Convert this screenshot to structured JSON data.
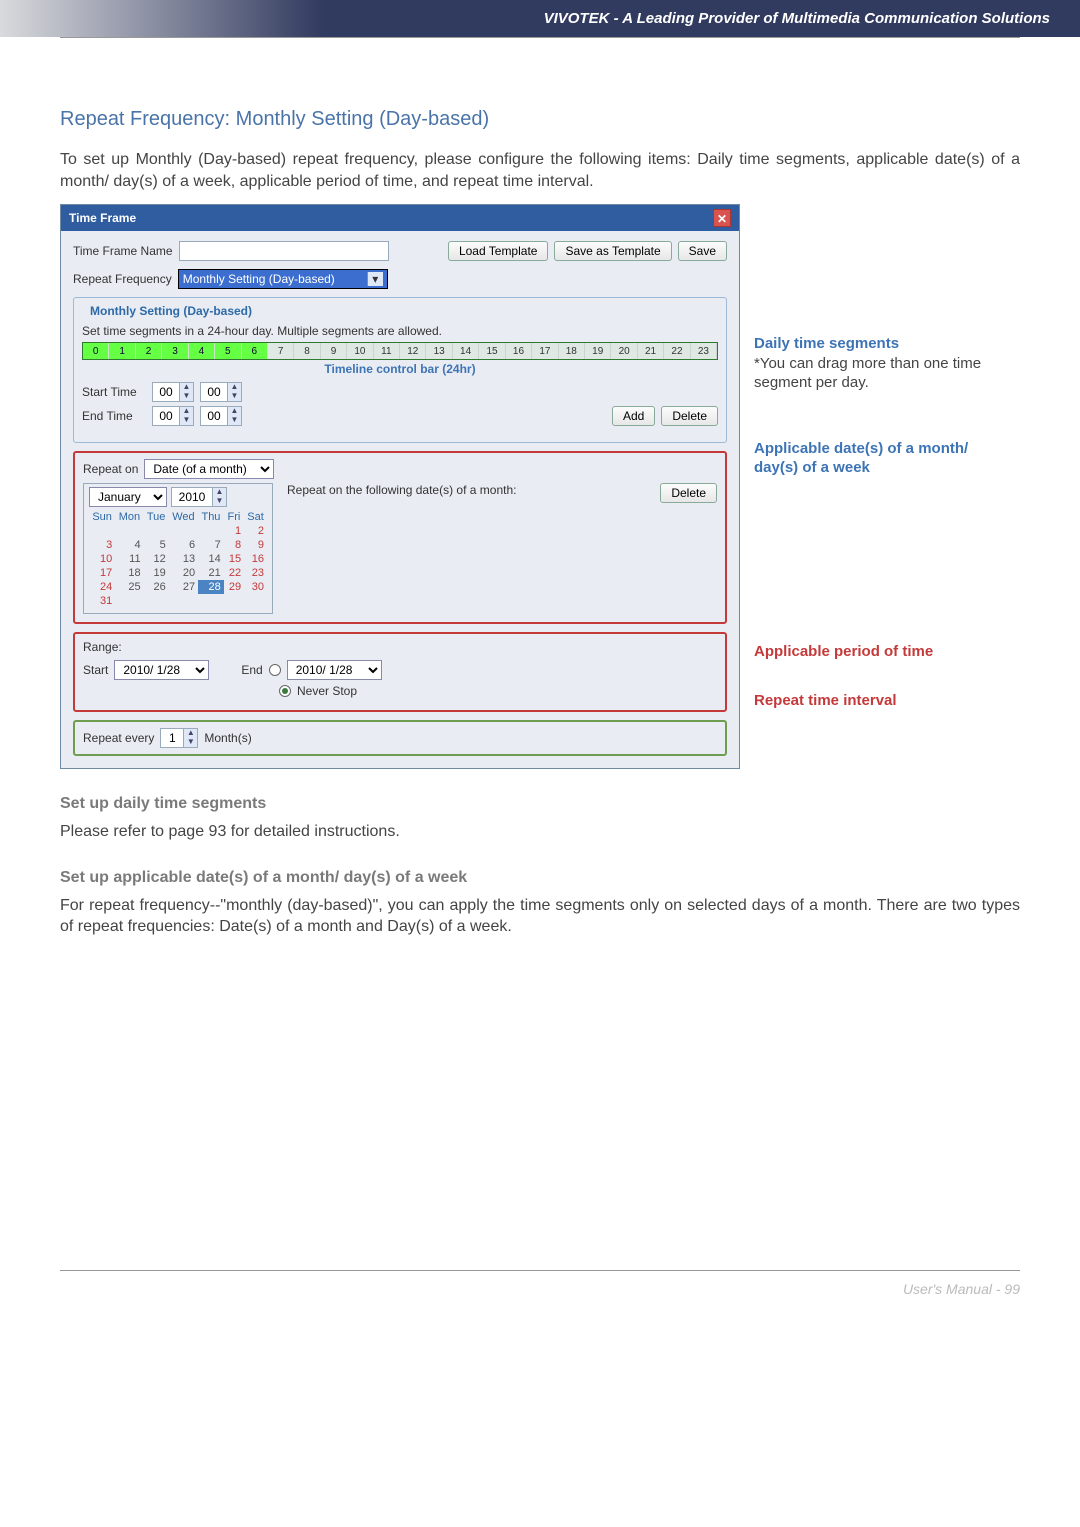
{
  "header": {
    "title": "VIVOTEK - A Leading Provider of Multimedia Communication Solutions"
  },
  "heading": "Repeat Frequency: Monthly Setting (Day-based)",
  "intro": "To set up Monthly (Day-based) repeat frequency, please configure the following items: Daily time segments, applicable date(s) of a month/ day(s) of a week, applicable period of time, and repeat time interval.",
  "dialog": {
    "title": "Time Frame",
    "name_label": "Time Frame Name",
    "name_value": "",
    "load_template_btn": "Load Template",
    "save_as_template_btn": "Save as Template",
    "save_btn": "Save",
    "freq_label": "Repeat Frequency",
    "freq_value": "Monthly Setting (Day-based)",
    "monthly": {
      "group_title": "Monthly Setting (Day-based)",
      "instructions": "Set time segments in a 24-hour day. Multiple segments are allowed.",
      "timeline_note": "Timeline control bar (24hr)",
      "hours": [
        "0",
        "1",
        "2",
        "3",
        "4",
        "5",
        "6",
        "7",
        "8",
        "9",
        "10",
        "11",
        "12",
        "13",
        "14",
        "15",
        "16",
        "17",
        "18",
        "19",
        "20",
        "21",
        "22",
        "23"
      ],
      "highlight_until": 7,
      "start_label": "Start Time",
      "start_h": "00",
      "start_m": "00",
      "end_label": "End Time",
      "end_h": "00",
      "end_m": "00",
      "add_btn": "Add",
      "delete_btn": "Delete"
    },
    "repeat_on": {
      "label": "Repeat on",
      "mode": "Date (of a month)",
      "note": "Repeat on the following date(s) of a month:",
      "cal_month": "January",
      "cal_year": "2010",
      "dow": [
        "Sun",
        "Mon",
        "Tue",
        "Wed",
        "Thu",
        "Fri",
        "Sat"
      ],
      "weeks": [
        [
          "",
          "",
          "",
          "",
          "",
          "1",
          "2"
        ],
        [
          "3",
          "4",
          "5",
          "6",
          "7",
          "8",
          "9"
        ],
        [
          "10",
          "11",
          "12",
          "13",
          "14",
          "15",
          "16"
        ],
        [
          "17",
          "18",
          "19",
          "20",
          "21",
          "22",
          "23"
        ],
        [
          "24",
          "25",
          "26",
          "27",
          "28",
          "29",
          "30"
        ],
        [
          "31",
          "",
          "",
          "",
          "",
          "",
          ""
        ]
      ],
      "selected_day": "28",
      "delete_btn": "Delete"
    },
    "range": {
      "label": "Range:",
      "start_label": "Start",
      "start_date": "2010/ 1/28",
      "end_label": "End",
      "end_date": "2010/ 1/28",
      "never_label": "Never Stop",
      "selected": "never"
    },
    "repeat": {
      "label": "Repeat every",
      "value": "1",
      "unit": "Month(s)"
    }
  },
  "annotations": {
    "a1_title": "Daily time segments",
    "a1_sub": "*You can drag more than one time segment per day.",
    "a2_title": "Applicable date(s) of a month/ day(s) of a week",
    "a3_title": "Applicable period of time",
    "a4_title": "Repeat time interval"
  },
  "sections": {
    "s1_head": "Set up daily time segments",
    "s1_body": "Please refer to page 93 for detailed instructions.",
    "s2_head": "Set up applicable date(s) of a month/ day(s) of a week",
    "s2_body": "For repeat frequency--\"monthly (day-based)\", you can apply the time segments only on selected days of a month. There are two types of repeat frequencies: Date(s) of a month and Day(s) of a week."
  },
  "footer": "User's Manual - 99"
}
